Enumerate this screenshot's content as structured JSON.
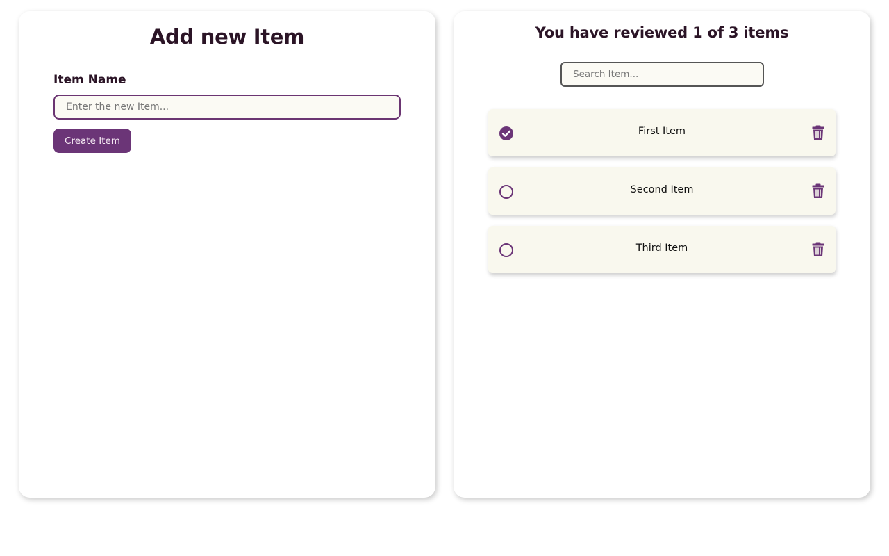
{
  "add_form": {
    "title": "Add new Item",
    "field_label": "Item Name",
    "input_placeholder": "Enter the new Item...",
    "input_value": "",
    "create_button_label": "Create Item"
  },
  "review_panel": {
    "title": "You have reviewed 1 of 3 items",
    "search_placeholder": "Search Item...",
    "items": [
      {
        "label": "First Item",
        "reviewed": true,
        "check_icon": "check-circle-icon",
        "delete_icon": "trash-icon"
      },
      {
        "label": "Second Item",
        "reviewed": false,
        "check_icon": "empty-circle-icon",
        "delete_icon": "trash-icon"
      },
      {
        "label": "Third Item",
        "reviewed": false,
        "check_icon": "empty-circle-icon",
        "delete_icon": "trash-icon"
      }
    ]
  },
  "colors": {
    "accent": "#6b3577",
    "heading": "#2b1426",
    "card_bg": "#f9f8ee",
    "input_bg": "#fbfaf4"
  }
}
